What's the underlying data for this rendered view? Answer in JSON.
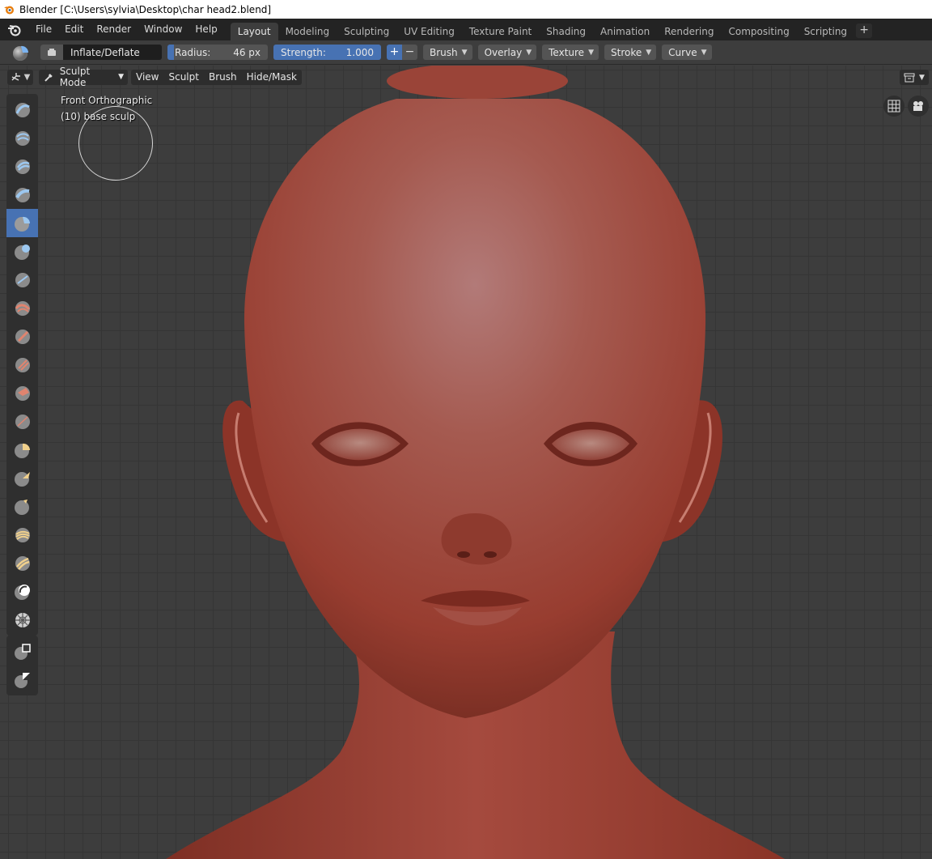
{
  "window": {
    "title": "Blender [C:\\Users\\sylvia\\Desktop\\char head2.blend]"
  },
  "menu": {
    "items": [
      "File",
      "Edit",
      "Render",
      "Window",
      "Help"
    ]
  },
  "workspaces": {
    "tabs": [
      "Layout",
      "Modeling",
      "Sculpting",
      "UV Editing",
      "Texture Paint",
      "Shading",
      "Animation",
      "Rendering",
      "Compositing",
      "Scripting"
    ],
    "active": "Layout",
    "add": "+"
  },
  "tool_settings": {
    "brush_name": "Inflate/Deflate",
    "radius_label": "Radius:",
    "radius_value": "46 px",
    "strength_label": "Strength:",
    "strength_value": "1.000",
    "plus": "+",
    "minus": "−",
    "dropdowns": [
      "Brush",
      "Overlay",
      "Texture",
      "Stroke",
      "Curve"
    ]
  },
  "viewport": {
    "mode": "Sculpt Mode",
    "menus": [
      "View",
      "Sculpt",
      "Brush",
      "Hide/Mask"
    ],
    "view_name": "Front Orthographic",
    "object_info": "(10) base sculp"
  },
  "colors": {
    "accent": "#4772b3",
    "skin": "#a6473a",
    "grid_bg": "#3d3d3d"
  },
  "tools": [
    "draw",
    "draw-sharp",
    "clay",
    "clay-strips",
    "inflate",
    "blob",
    "crease",
    "smooth",
    "flatten",
    "fill",
    "scrape",
    "pinch",
    "grab",
    "snake-hook",
    "thumb",
    "nudge",
    "rotate",
    "simplify",
    "mask",
    "box-mask",
    "lasso-mask"
  ]
}
